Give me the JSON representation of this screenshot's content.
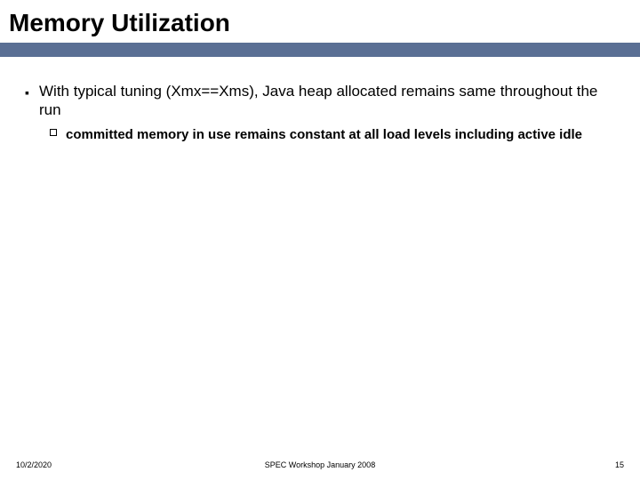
{
  "title": "Memory Utilization",
  "bullets": {
    "lvl1_text": "With typical tuning (Xmx==Xms), Java heap allocated remains same throughout the run",
    "lvl2_text": "committed memory in use remains constant at all load levels including active idle"
  },
  "footer": {
    "date": "10/2/2020",
    "center": "SPEC Workshop January 2008",
    "page": "15"
  }
}
